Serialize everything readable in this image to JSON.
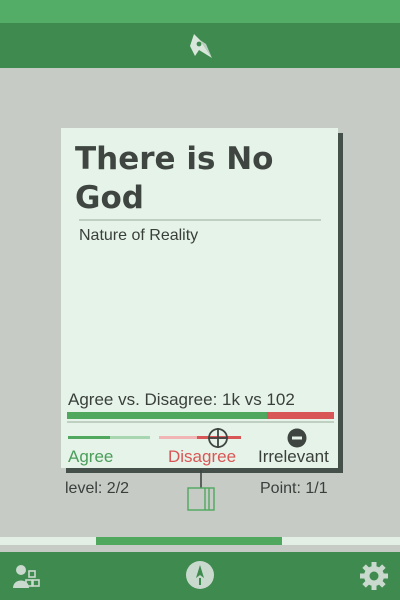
{
  "card": {
    "title": "There is No God",
    "category": "Nature of Reality",
    "votes_text": "Agree vs. Disagree: 1k vs 102",
    "agree_fraction": 0.75,
    "agree_label": "Agree",
    "disagree_label": "Disagree",
    "irrelevant_label": "Irrelevant"
  },
  "footer": {
    "level": "level: 2/2",
    "point": "Point: 1/1"
  },
  "progress": {
    "fraction_start": 0.24,
    "fraction_end": 0.705
  },
  "icons": {
    "top": "logo-icon",
    "target": "crosshair-icon",
    "irrelevant": "minus-circle-icon",
    "tree": "tree-icon",
    "nav_left": "people-icon",
    "nav_center": "compass-icon",
    "nav_right": "gear-icon"
  },
  "colors": {
    "accent_green": "#4fa85e",
    "header_green": "#3f8a4e",
    "disagree_red": "#d95656",
    "card_bg": "#e6f3e8",
    "page_bg": "#c7cbc6"
  }
}
